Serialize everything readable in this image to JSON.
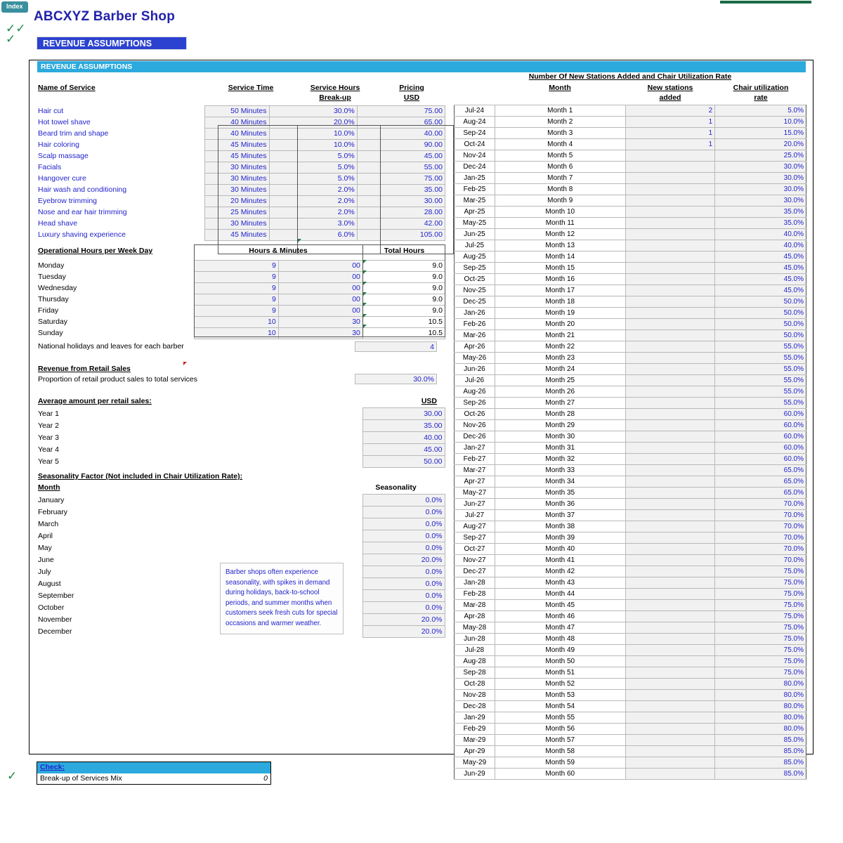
{
  "window": {
    "index_tab": "Index",
    "page_title": "ABCXYZ Barber Shop",
    "section_banner": "REVENUE ASSUMPTIONS",
    "frame_header": "REVENUE ASSUMPTIONS",
    "accent_cyan": "#2CA9DD",
    "accent_blue": "#2A42CF",
    "text_blue": "#2222CC",
    "check_green": "#1E8C4A",
    "top_bar_green": "#1A6B45"
  },
  "services": {
    "headers": {
      "name": "Name of Service",
      "time": "Service Time",
      "hours_1": "Service Hours ",
      "hours_2": "Break-up",
      "price_1": "Pricing",
      "price_2": "USD"
    },
    "rows": [
      {
        "name": "Hair cut",
        "time": "50 Minutes",
        "breakup": "30.0%",
        "price": "75.00"
      },
      {
        "name": "Hot towel shave",
        "time": "40 Minutes",
        "breakup": "20.0%",
        "price": "65.00"
      },
      {
        "name": "Beard trim and shape",
        "time": "40 Minutes",
        "breakup": "10.0%",
        "price": "40.00"
      },
      {
        "name": "Hair coloring",
        "time": "45 Minutes",
        "breakup": "10.0%",
        "price": "90.00"
      },
      {
        "name": "Scalp massage",
        "time": "45 Minutes",
        "breakup": "5.0%",
        "price": "45.00"
      },
      {
        "name": "Facials",
        "time": "30 Minutes",
        "breakup": "5.0%",
        "price": "55.00"
      },
      {
        "name": "Hangover cure",
        "time": "30 Minutes",
        "breakup": "5.0%",
        "price": "75.00"
      },
      {
        "name": "Hair wash and conditioning",
        "time": "30 Minutes",
        "breakup": "2.0%",
        "price": "35.00"
      },
      {
        "name": "Eyebrow trimming",
        "time": "20 Minutes",
        "breakup": "2.0%",
        "price": "30.00"
      },
      {
        "name": "Nose and ear hair trimming",
        "time": "25 Minutes",
        "breakup": "2.0%",
        "price": "28.00"
      },
      {
        "name": "Head shave",
        "time": "30 Minutes",
        "breakup": "3.0%",
        "price": "42.00"
      },
      {
        "name": "Luxury shaving experience",
        "time": "45 Minutes",
        "breakup": "6.0%",
        "price": "105.00"
      }
    ]
  },
  "operational_hours": {
    "title": "Operational Hours  per Week Day",
    "header_hours": "Hours & Minutes",
    "header_total": "Total Hours",
    "rows": [
      {
        "day": "Monday",
        "hours": "9",
        "minutes": "00",
        "total": "9.0"
      },
      {
        "day": "Tuesday",
        "hours": "9",
        "minutes": "00",
        "total": "9.0"
      },
      {
        "day": "Wednesday",
        "hours": "9",
        "minutes": "00",
        "total": "9.0"
      },
      {
        "day": "Thursday",
        "hours": "9",
        "minutes": "00",
        "total": "9.0"
      },
      {
        "day": "Friday",
        "hours": "9",
        "minutes": "00",
        "total": "9.0"
      },
      {
        "day": "Saturday",
        "hours": "10",
        "minutes": "30",
        "total": "10.5"
      },
      {
        "day": "Sunday",
        "hours": "10",
        "minutes": "30",
        "total": "10.5"
      }
    ]
  },
  "holidays": {
    "label": "National holidays and leaves for each barber",
    "value": "4"
  },
  "retail": {
    "title": "Revenue from Retail Sales",
    "proportion_label": "Proportion of retail product sales to total services",
    "proportion_value": "30.0%",
    "avg_title": "Average amount per retail sales:",
    "avg_unit": "USD",
    "years": [
      {
        "label": "Year 1",
        "value": "30.00"
      },
      {
        "label": "Year 2",
        "value": "35.00"
      },
      {
        "label": "Year 3",
        "value": "40.00"
      },
      {
        "label": "Year 4",
        "value": "45.00"
      },
      {
        "label": "Year 5",
        "value": "50.00"
      }
    ]
  },
  "seasonality": {
    "title": "Seasonality Factor (Not included in Chair Utilization Rate):",
    "month_header": "Month",
    "value_header": "Seasonality",
    "note": "Barber shops often experience seasonality, with spikes in demand during holidays, back-to-school periods, and summer months when customers seek fresh cuts for special occasions and warmer weather.",
    "rows": [
      {
        "month": "January",
        "value": "0.0%"
      },
      {
        "month": "February",
        "value": "0.0%"
      },
      {
        "month": "March",
        "value": "0.0%"
      },
      {
        "month": "April",
        "value": "0.0%"
      },
      {
        "month": "May",
        "value": "0.0%"
      },
      {
        "month": "June",
        "value": "20.0%"
      },
      {
        "month": "July",
        "value": "0.0%"
      },
      {
        "month": "August",
        "value": "0.0%"
      },
      {
        "month": "September",
        "value": "0.0%"
      },
      {
        "month": "October",
        "value": "0.0%"
      },
      {
        "month": "November",
        "value": "20.0%"
      },
      {
        "month": "December",
        "value": "20.0%"
      }
    ]
  },
  "stations": {
    "title": "Number Of New Stations Added and Chair Utilization Rate",
    "header_month": "Month",
    "header_new_1": "New stations",
    "header_new_2": "added",
    "header_util_1": "Chair utilization ",
    "header_util_2": "rate",
    "rows": [
      {
        "date": "Jul-24",
        "month": "Month 1",
        "added": "2",
        "util": "5.0%"
      },
      {
        "date": "Aug-24",
        "month": "Month 2",
        "added": "1",
        "util": "10.0%"
      },
      {
        "date": "Sep-24",
        "month": "Month 3",
        "added": "1",
        "util": "15.0%"
      },
      {
        "date": "Oct-24",
        "month": "Month 4",
        "added": "1",
        "util": "20.0%"
      },
      {
        "date": "Nov-24",
        "month": "Month 5",
        "added": "",
        "util": "25.0%"
      },
      {
        "date": "Dec-24",
        "month": "Month 6",
        "added": "",
        "util": "30.0%"
      },
      {
        "date": "Jan-25",
        "month": "Month 7",
        "added": "",
        "util": "30.0%"
      },
      {
        "date": "Feb-25",
        "month": "Month 8",
        "added": "",
        "util": "30.0%"
      },
      {
        "date": "Mar-25",
        "month": "Month 9",
        "added": "",
        "util": "30.0%"
      },
      {
        "date": "Apr-25",
        "month": "Month 10",
        "added": "",
        "util": "35.0%"
      },
      {
        "date": "May-25",
        "month": "Month 11",
        "added": "",
        "util": "35.0%"
      },
      {
        "date": "Jun-25",
        "month": "Month 12",
        "added": "",
        "util": "40.0%"
      },
      {
        "date": "Jul-25",
        "month": "Month 13",
        "added": "",
        "util": "40.0%"
      },
      {
        "date": "Aug-25",
        "month": "Month 14",
        "added": "",
        "util": "45.0%"
      },
      {
        "date": "Sep-25",
        "month": "Month 15",
        "added": "",
        "util": "45.0%"
      },
      {
        "date": "Oct-25",
        "month": "Month 16",
        "added": "",
        "util": "45.0%"
      },
      {
        "date": "Nov-25",
        "month": "Month 17",
        "added": "",
        "util": "45.0%"
      },
      {
        "date": "Dec-25",
        "month": "Month 18",
        "added": "",
        "util": "50.0%"
      },
      {
        "date": "Jan-26",
        "month": "Month 19",
        "added": "",
        "util": "50.0%"
      },
      {
        "date": "Feb-26",
        "month": "Month 20",
        "added": "",
        "util": "50.0%"
      },
      {
        "date": "Mar-26",
        "month": "Month 21",
        "added": "",
        "util": "50.0%"
      },
      {
        "date": "Apr-26",
        "month": "Month 22",
        "added": "",
        "util": "55.0%"
      },
      {
        "date": "May-26",
        "month": "Month 23",
        "added": "",
        "util": "55.0%"
      },
      {
        "date": "Jun-26",
        "month": "Month 24",
        "added": "",
        "util": "55.0%"
      },
      {
        "date": "Jul-26",
        "month": "Month 25",
        "added": "",
        "util": "55.0%"
      },
      {
        "date": "Aug-26",
        "month": "Month 26",
        "added": "",
        "util": "55.0%"
      },
      {
        "date": "Sep-26",
        "month": "Month 27",
        "added": "",
        "util": "55.0%"
      },
      {
        "date": "Oct-26",
        "month": "Month 28",
        "added": "",
        "util": "60.0%"
      },
      {
        "date": "Nov-26",
        "month": "Month 29",
        "added": "",
        "util": "60.0%"
      },
      {
        "date": "Dec-26",
        "month": "Month 30",
        "added": "",
        "util": "60.0%"
      },
      {
        "date": "Jan-27",
        "month": "Month 31",
        "added": "",
        "util": "60.0%"
      },
      {
        "date": "Feb-27",
        "month": "Month 32",
        "added": "",
        "util": "60.0%"
      },
      {
        "date": "Mar-27",
        "month": "Month 33",
        "added": "",
        "util": "65.0%"
      },
      {
        "date": "Apr-27",
        "month": "Month 34",
        "added": "",
        "util": "65.0%"
      },
      {
        "date": "May-27",
        "month": "Month 35",
        "added": "",
        "util": "65.0%"
      },
      {
        "date": "Jun-27",
        "month": "Month 36",
        "added": "",
        "util": "70.0%"
      },
      {
        "date": "Jul-27",
        "month": "Month 37",
        "added": "",
        "util": "70.0%"
      },
      {
        "date": "Aug-27",
        "month": "Month 38",
        "added": "",
        "util": "70.0%"
      },
      {
        "date": "Sep-27",
        "month": "Month 39",
        "added": "",
        "util": "70.0%"
      },
      {
        "date": "Oct-27",
        "month": "Month 40",
        "added": "",
        "util": "70.0%"
      },
      {
        "date": "Nov-27",
        "month": "Month 41",
        "added": "",
        "util": "70.0%"
      },
      {
        "date": "Dec-27",
        "month": "Month 42",
        "added": "",
        "util": "75.0%"
      },
      {
        "date": "Jan-28",
        "month": "Month 43",
        "added": "",
        "util": "75.0%"
      },
      {
        "date": "Feb-28",
        "month": "Month 44",
        "added": "",
        "util": "75.0%"
      },
      {
        "date": "Mar-28",
        "month": "Month 45",
        "added": "",
        "util": "75.0%"
      },
      {
        "date": "Apr-28",
        "month": "Month 46",
        "added": "",
        "util": "75.0%"
      },
      {
        "date": "May-28",
        "month": "Month 47",
        "added": "",
        "util": "75.0%"
      },
      {
        "date": "Jun-28",
        "month": "Month 48",
        "added": "",
        "util": "75.0%"
      },
      {
        "date": "Jul-28",
        "month": "Month 49",
        "added": "",
        "util": "75.0%"
      },
      {
        "date": "Aug-28",
        "month": "Month 50",
        "added": "",
        "util": "75.0%"
      },
      {
        "date": "Sep-28",
        "month": "Month 51",
        "added": "",
        "util": "75.0%"
      },
      {
        "date": "Oct-28",
        "month": "Month 52",
        "added": "",
        "util": "80.0%"
      },
      {
        "date": "Nov-28",
        "month": "Month 53",
        "added": "",
        "util": "80.0%"
      },
      {
        "date": "Dec-28",
        "month": "Month 54",
        "added": "",
        "util": "80.0%"
      },
      {
        "date": "Jan-29",
        "month": "Month 55",
        "added": "",
        "util": "80.0%"
      },
      {
        "date": "Feb-29",
        "month": "Month 56",
        "added": "",
        "util": "80.0%"
      },
      {
        "date": "Mar-29",
        "month": "Month 57",
        "added": "",
        "util": "85.0%"
      },
      {
        "date": "Apr-29",
        "month": "Month 58",
        "added": "",
        "util": "85.0%"
      },
      {
        "date": "May-29",
        "month": "Month 59",
        "added": "",
        "util": "85.0%"
      },
      {
        "date": "Jun-29",
        "month": "Month 60",
        "added": "",
        "util": "85.0%"
      }
    ]
  },
  "check": {
    "header": "Check:",
    "label": "Break-up of Services Mix",
    "value": "0"
  }
}
